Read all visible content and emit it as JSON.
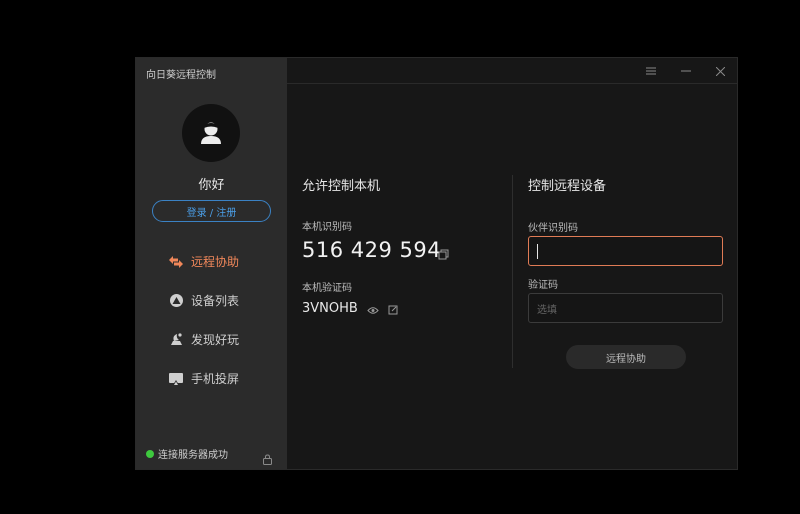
{
  "app": {
    "title": "向日葵远程控制"
  },
  "user": {
    "greeting": "你好",
    "login_label": "登录 / 注册"
  },
  "nav": {
    "items": [
      {
        "label": "远程协助",
        "icon": "remote-assist-icon",
        "active": true
      },
      {
        "label": "设备列表",
        "icon": "device-list-icon",
        "active": false
      },
      {
        "label": "发现好玩",
        "icon": "discover-icon",
        "active": false
      },
      {
        "label": "手机投屏",
        "icon": "screen-cast-icon",
        "active": false
      }
    ]
  },
  "status": {
    "text": "连接服务器成功",
    "color": "#3ec93e"
  },
  "allow_control": {
    "title": "允许控制本机",
    "device_id_label": "本机识别码",
    "device_id": "516 429 594",
    "verify_label": "本机验证码",
    "verify_code": "3VNOHB"
  },
  "remote_control": {
    "title": "控制远程设备",
    "partner_label": "伙伴识别码",
    "partner_value": "",
    "verify_label": "验证码",
    "verify_placeholder": "选填",
    "connect_label": "远程协助"
  },
  "colors": {
    "accent": "#f0875a",
    "login_blue": "#4b9fe8"
  }
}
